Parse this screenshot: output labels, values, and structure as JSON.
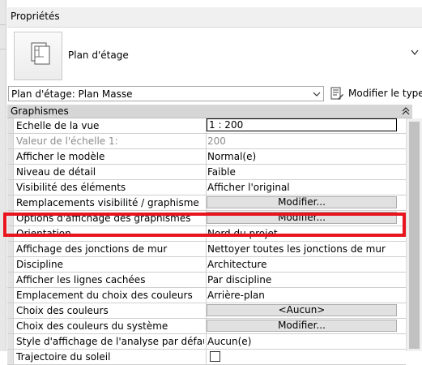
{
  "panel": {
    "title": "Propriétés",
    "type_name": "Plan d'étage",
    "type_selector_value": "Plan d'étage: Plan Masse",
    "modify_type_label": "Modifier le type"
  },
  "group": {
    "label": "Graphismes"
  },
  "rows": [
    {
      "name": "Echelle de la vue",
      "value": "1 : 200",
      "kind": "edit"
    },
    {
      "name": "Valeur de l'échelle    1:",
      "value": "200",
      "kind": "grey"
    },
    {
      "name": "Afficher le modèle",
      "value": "Normal(e)",
      "kind": "text"
    },
    {
      "name": "Niveau de détail",
      "value": "Faible",
      "kind": "text"
    },
    {
      "name": "Visibilité des éléments",
      "value": "Afficher l'original",
      "kind": "text"
    },
    {
      "name": "Remplacements visibilité / graphisme",
      "value": "Modifier...",
      "kind": "button"
    },
    {
      "name": "Options d'affichage des graphismes",
      "value": "Modifier...",
      "kind": "button"
    },
    {
      "name": "Orientation",
      "value": "Nord du projet",
      "kind": "text"
    },
    {
      "name": "Affichage des jonctions de mur",
      "value": "Nettoyer toutes les jonctions de mur",
      "kind": "text"
    },
    {
      "name": "Discipline",
      "value": "Architecture",
      "kind": "text"
    },
    {
      "name": "Afficher les lignes cachées",
      "value": "Par discipline",
      "kind": "text"
    },
    {
      "name": "Emplacement du choix des couleurs",
      "value": "Arrière-plan",
      "kind": "text"
    },
    {
      "name": "Choix des couleurs",
      "value": "<Aucun>",
      "kind": "button"
    },
    {
      "name": "Choix des couleurs du système",
      "value": "Modifier...",
      "kind": "button"
    },
    {
      "name": "Style d'affichage de l'analyse par défaut",
      "value": "Aucun(e)",
      "kind": "text"
    },
    {
      "name": "Trajectoire du soleil",
      "value": "",
      "kind": "checkbox",
      "checked": false
    }
  ],
  "colors": {
    "highlight": "#e8141e",
    "group_header": "#d6d6d6",
    "button": "#e1e1e1"
  },
  "icons": {
    "type_icon": "floor-plan-icon",
    "modify_type_icon": "edit-type-icon",
    "dropdown": "chevron-down-icon",
    "collapse": "collapse-up-icon"
  }
}
